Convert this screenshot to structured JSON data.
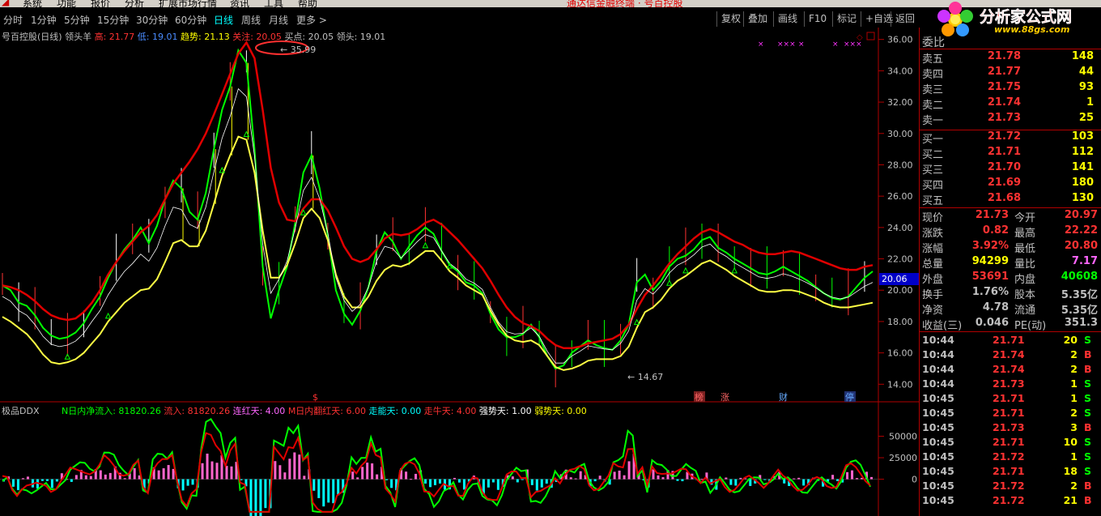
{
  "menu": {
    "items": [
      "系统",
      "功能",
      "报价",
      "分析",
      "扩展市场行情",
      "资讯",
      "工具",
      "帮助"
    ],
    "center": "通达信金融终端 · 号百控股"
  },
  "periods": {
    "items": [
      "分时",
      "1分钟",
      "5分钟",
      "15分钟",
      "30分钟",
      "60分钟",
      "日线",
      "周线",
      "月线",
      "更多 >"
    ],
    "active": "日线"
  },
  "toolbar": {
    "buttons": [
      "复权",
      "叠加",
      "画线",
      "F10",
      "标记",
      "+自选",
      "返回"
    ]
  },
  "chart_info": {
    "stock": "号百控股(日线)",
    "indicator": "领头羊",
    "high_label": "高: 21.77",
    "low_label": "低: 19.01",
    "trend_label": "趋势: 21.13",
    "focus_label": "关注: 20.05",
    "buy_label": "买点: 20.05",
    "lead_label": "领头: 19.01"
  },
  "markers": {
    "peak": "35.99",
    "trough": "14.67",
    "events": [
      "$",
      "榜",
      "涨",
      "财",
      "停"
    ]
  },
  "price_tag": "20.06",
  "ddx": {
    "name": "极品DDX",
    "l1": "N日内净流入: 81820.26",
    "l2": "流入: 81820.26",
    "l3": "连红天: 4.00",
    "l4": "M日内翻红天: 6.00",
    "l5": "走能天: 0.00",
    "l6": "走牛天: 4.00",
    "l7": "强势天: 1.00",
    "l8": "弱势天: 0.00"
  },
  "colors": {
    "up": "#ff3232",
    "down": "#00ff00",
    "yellow": "#ffff00",
    "cyan": "#00ffff",
    "magenta": "#ff66cc"
  },
  "chart_data": {
    "type": "line",
    "ylim": [
      13.5,
      36.5
    ],
    "y_ticks": [
      "36.00",
      "34.00",
      "32.00",
      "30.00",
      "28.00",
      "26.00",
      "24.00",
      "22.00",
      "20.00",
      "18.00",
      "16.00",
      "14.00"
    ],
    "x": [
      0,
      1,
      2,
      3,
      4,
      5,
      6,
      7,
      8,
      9,
      10,
      11,
      12,
      13,
      14,
      15,
      16,
      17,
      18,
      19,
      20,
      21,
      22,
      23,
      24,
      25,
      26,
      27,
      28,
      29,
      30,
      31,
      32,
      33,
      34,
      35,
      36,
      37,
      38,
      39,
      40,
      41,
      42,
      43,
      44,
      45,
      46,
      47,
      48,
      49,
      50,
      51,
      52,
      53,
      54,
      55,
      56,
      57,
      58,
      59,
      60,
      61,
      62,
      63,
      64,
      65,
      66,
      67,
      68,
      69,
      70,
      71,
      72,
      73,
      74,
      75,
      76,
      77,
      78,
      79,
      80,
      81,
      82,
      83,
      84,
      85,
      86,
      87,
      88,
      89,
      90,
      91,
      92,
      93,
      94,
      95,
      96,
      97,
      98,
      99,
      100,
      101,
      102,
      103,
      104,
      105,
      106,
      107
    ],
    "series": [
      {
        "values": [
          20.3,
          20.0,
          19.2,
          19.0,
          18.4,
          17.6,
          17.1,
          16.9,
          17.0,
          17.3,
          17.9,
          18.8,
          19.6,
          20.8,
          21.8,
          22.6,
          23.2,
          24.0,
          23.0,
          24.1,
          25.8,
          27.0,
          26.5,
          25.0,
          24.5,
          26.2,
          29.0,
          31.5,
          33.0,
          35.3,
          34.5,
          29.0,
          21.5,
          18.2,
          20.0,
          21.5,
          24.3,
          27.5,
          28.6,
          26.5,
          23.5,
          20.0,
          18.5,
          17.8,
          18.7,
          20.2,
          22.5,
          23.7,
          23.1,
          22.0,
          22.8,
          23.5,
          24.0,
          23.6,
          22.5,
          21.6,
          21.2,
          20.5,
          20.3,
          19.8,
          18.5,
          17.5,
          17.0,
          17.0,
          17.2,
          17.8,
          17.0,
          15.8,
          15.0,
          15.2,
          16.0,
          16.4,
          16.8,
          16.5,
          16.3,
          16.2,
          16.8,
          17.8,
          20.5,
          21.0,
          20.0,
          20.6,
          21.5,
          22.0,
          22.2,
          22.6,
          23.2,
          23.4,
          22.7,
          22.4,
          22.0,
          21.7,
          21.4,
          21.1,
          21.0,
          21.2,
          21.5,
          21.2,
          20.9,
          20.6,
          20.2,
          19.8,
          19.5,
          19.4,
          19.6,
          20.2,
          20.8,
          21.2
        ]
      },
      {
        "values": [
          20.3,
          20.2,
          20.0,
          19.7,
          19.3,
          18.8,
          18.4,
          18.2,
          18.1,
          18.2,
          18.6,
          19.2,
          20.0,
          21.0,
          21.8,
          22.5,
          23.1,
          23.7,
          24.1,
          24.8,
          25.8,
          26.8,
          27.5,
          28.2,
          29.0,
          30.0,
          31.2,
          32.5,
          33.8,
          35.1,
          35.8,
          34.8,
          31.5,
          27.8,
          25.6,
          24.5,
          24.4,
          25.2,
          25.8,
          25.8,
          25.1,
          24.0,
          22.8,
          22.0,
          21.8,
          22.0,
          22.6,
          23.3,
          23.6,
          23.5,
          23.6,
          23.9,
          24.3,
          24.5,
          24.2,
          23.7,
          23.2,
          22.6,
          22.0,
          21.4,
          20.6,
          19.7,
          18.9,
          18.3,
          17.9,
          17.7,
          17.4,
          16.9,
          16.5,
          16.3,
          16.3,
          16.4,
          16.6,
          16.7,
          16.8,
          16.9,
          17.2,
          17.8,
          18.8,
          19.7,
          20.3,
          21.0,
          21.7,
          22.3,
          22.8,
          23.3,
          23.7,
          23.9,
          23.7,
          23.4,
          23.1,
          22.9,
          22.6,
          22.4,
          22.3,
          22.3,
          22.4,
          22.5,
          22.4,
          22.2,
          22.0,
          21.8,
          21.6,
          21.4,
          21.3,
          21.3,
          21.5,
          21.6
        ]
      },
      {
        "values": [
          18.3,
          18.0,
          17.6,
          17.2,
          16.6,
          15.9,
          15.4,
          15.3,
          15.4,
          15.6,
          16.0,
          16.6,
          17.2,
          18.0,
          18.6,
          19.2,
          19.6,
          20.0,
          20.1,
          20.7,
          21.8,
          23.0,
          23.2,
          22.8,
          22.8,
          23.8,
          25.5,
          27.3,
          28.6,
          29.8,
          29.6,
          27.5,
          23.8,
          20.8,
          20.8,
          21.6,
          23.0,
          24.6,
          25.2,
          24.6,
          23.2,
          21.0,
          19.6,
          18.9,
          18.9,
          19.6,
          20.6,
          21.3,
          21.6,
          21.5,
          21.7,
          22.1,
          22.5,
          22.5,
          21.9,
          21.2,
          20.8,
          20.3,
          20.0,
          19.7,
          18.7,
          17.8,
          17.1,
          16.8,
          16.7,
          16.8,
          16.5,
          15.8,
          15.1,
          14.9,
          15.0,
          15.2,
          15.5,
          15.6,
          15.6,
          15.6,
          15.8,
          16.4,
          17.6,
          18.6,
          18.9,
          19.4,
          20.1,
          20.6,
          20.9,
          21.3,
          21.7,
          21.9,
          21.6,
          21.3,
          20.9,
          20.6,
          20.3,
          20.0,
          19.9,
          19.9,
          20.0,
          20.0,
          19.9,
          19.7,
          19.5,
          19.2,
          19.0,
          18.9,
          18.9,
          19.0,
          19.1,
          19.2
        ]
      }
    ]
  },
  "ddx_data": {
    "ylim": [
      -40000,
      75000
    ],
    "y_ticks": [
      "50000",
      "25000",
      "0"
    ]
  },
  "quote": {
    "header": "委比",
    "sell": [
      {
        "label": "卖五",
        "price": "21.78",
        "vol": "148"
      },
      {
        "label": "卖四",
        "price": "21.77",
        "vol": "44"
      },
      {
        "label": "卖三",
        "price": "21.75",
        "vol": "93"
      },
      {
        "label": "卖二",
        "price": "21.74",
        "vol": "1"
      },
      {
        "label": "卖一",
        "price": "21.73",
        "vol": "25"
      }
    ],
    "buy": [
      {
        "label": "买一",
        "price": "21.72",
        "vol": "103"
      },
      {
        "label": "买二",
        "price": "21.71",
        "vol": "112"
      },
      {
        "label": "买三",
        "price": "21.70",
        "vol": "141"
      },
      {
        "label": "买四",
        "price": "21.69",
        "vol": "180"
      },
      {
        "label": "买五",
        "price": "21.68",
        "vol": "130"
      }
    ],
    "stats": [
      {
        "a": "现价",
        "b": "21.73",
        "c": "今开",
        "d": "20.97",
        "bc": "#ff3232",
        "dc": "#ff3232"
      },
      {
        "a": "涨跌",
        "b": "0.82",
        "c": "最高",
        "d": "22.22",
        "bc": "#ff3232",
        "dc": "#ff3232"
      },
      {
        "a": "涨幅",
        "b": "3.92%",
        "c": "最低",
        "d": "20.80",
        "bc": "#ff3232",
        "dc": "#ff3232"
      },
      {
        "a": "总量",
        "b": "94299",
        "c": "量比",
        "d": "7.17",
        "bc": "#ffff00",
        "dc": "#ff66ff"
      },
      {
        "a": "外盘",
        "b": "53691",
        "c": "内盘",
        "d": "40608",
        "bc": "#ff3232",
        "dc": "#00ff00"
      },
      {
        "a": "换手",
        "b": "1.76%",
        "c": "股本",
        "d": "5.35亿",
        "bc": "#c0c0c0",
        "dc": "#c0c0c0"
      },
      {
        "a": "净资",
        "b": "4.78",
        "c": "流通",
        "d": "5.35亿",
        "bc": "#c0c0c0",
        "dc": "#c0c0c0"
      },
      {
        "a": "收益(三)",
        "b": "0.046",
        "c": "PE(动)",
        "d": "351.3",
        "bc": "#c0c0c0",
        "dc": "#c0c0c0"
      }
    ],
    "ticks": [
      {
        "t": "10:44",
        "p": "21.71",
        "v": "20",
        "s": "S"
      },
      {
        "t": "10:44",
        "p": "21.74",
        "v": "2",
        "s": "B"
      },
      {
        "t": "10:44",
        "p": "21.74",
        "v": "2",
        "s": "B"
      },
      {
        "t": "10:44",
        "p": "21.73",
        "v": "1",
        "s": "S"
      },
      {
        "t": "10:45",
        "p": "21.71",
        "v": "1",
        "s": "S"
      },
      {
        "t": "10:45",
        "p": "21.71",
        "v": "2",
        "s": "S"
      },
      {
        "t": "10:45",
        "p": "21.73",
        "v": "3",
        "s": "B"
      },
      {
        "t": "10:45",
        "p": "21.71",
        "v": "10",
        "s": "S"
      },
      {
        "t": "10:45",
        "p": "21.72",
        "v": "1",
        "s": "S"
      },
      {
        "t": "10:45",
        "p": "21.71",
        "v": "18",
        "s": "S"
      },
      {
        "t": "10:45",
        "p": "21.72",
        "v": "2",
        "s": "B"
      },
      {
        "t": "10:45",
        "p": "21.72",
        "v": "21",
        "s": "B"
      }
    ]
  },
  "logo": {
    "cn": "分析家公式网",
    "url": "www.88gs.com"
  }
}
